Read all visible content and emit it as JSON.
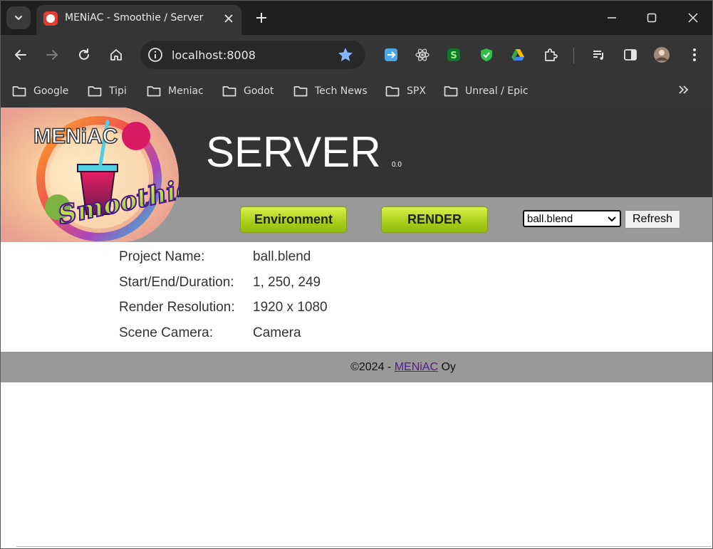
{
  "browser": {
    "tab": {
      "title": "MENiAC - Smoothie / Server",
      "favicon": "app-favicon-icon"
    },
    "window_controls": [
      "minimize-icon",
      "maximize-icon",
      "close-icon"
    ],
    "address": {
      "url": "localhost:8008"
    },
    "bookmarks": [
      {
        "label": "Google"
      },
      {
        "label": "Tipi"
      },
      {
        "label": "Meniac"
      },
      {
        "label": "Godot"
      },
      {
        "label": "Tech News"
      },
      {
        "label": "SPX"
      },
      {
        "label": "Unreal / Epic"
      }
    ],
    "extensions": [
      "translate-icon",
      "react-icon",
      "extension-s-icon",
      "shield-check-icon",
      "google-drive-icon",
      "puzzle-icon",
      "media-queue-icon",
      "side-panel-icon",
      "avatar",
      "more-menu-icon"
    ]
  },
  "header": {
    "logo_text_top": "MENiAC",
    "logo_text_main": "Smoothie",
    "title": "SERVER",
    "version": "0.0",
    "environment_label": "Environment",
    "render_label": "RENDER",
    "project_select": {
      "selected": "ball.blend"
    },
    "refresh_label": "Refresh"
  },
  "info": [
    {
      "label": "Project Name:",
      "value": "ball.blend"
    },
    {
      "label": "Start/End/Duration:",
      "value": "1, 250, 249"
    },
    {
      "label": "Render Resolution:",
      "value": "1920 x 1080"
    },
    {
      "label": "Scene Camera:",
      "value": "Camera"
    }
  ],
  "footer": {
    "prefix": "©2024 - ",
    "link": "MENiAC",
    "suffix": " Oy"
  },
  "colors": {
    "header_dark": "#333333",
    "header_gray": "#999999",
    "button_green": "#b5d622",
    "link_purple": "#551a8b"
  }
}
